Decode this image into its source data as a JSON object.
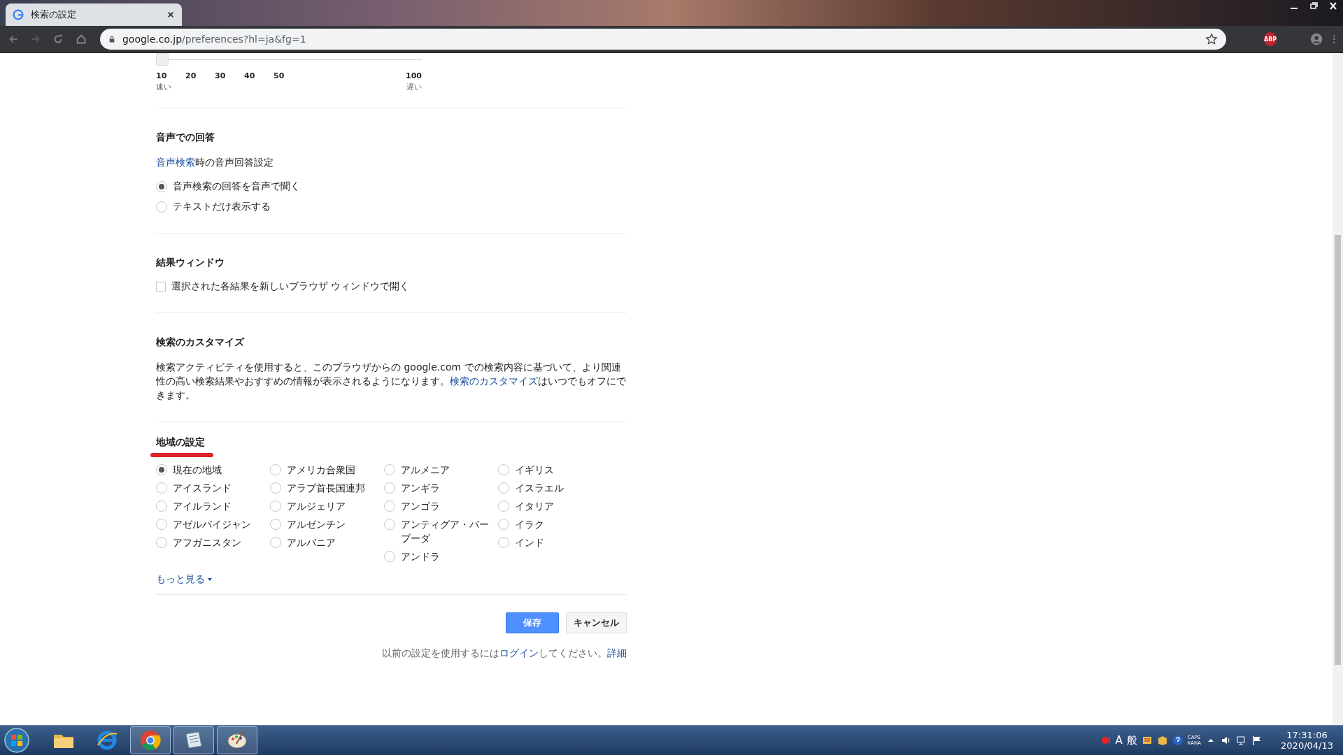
{
  "browser": {
    "tab": {
      "title": "検索の設定"
    },
    "address": {
      "host": "google.co.jp",
      "path": "/preferences?hl=ja&fg=1"
    },
    "extension_badge": "ABP"
  },
  "page": {
    "slider": {
      "ticks": [
        "10",
        "20",
        "30",
        "40",
        "50",
        "100"
      ],
      "low_label": "速い",
      "high_label": "遅い",
      "level": 0
    },
    "voice": {
      "heading": "音声での回答",
      "description": [
        {
          "text": "音声検索",
          "link": true
        },
        {
          "text": "時の音声回答設定",
          "link": false
        }
      ],
      "options": [
        {
          "label": "音声検索の回答を音声で聞く",
          "selected": true
        },
        {
          "label": "テキストだけ表示する",
          "selected": false
        }
      ]
    },
    "results_window": {
      "heading": "結果ウィンドウ",
      "checkbox": {
        "label": "選択された各結果を新しいブラウザ ウィンドウで開く",
        "checked": false
      }
    },
    "customize": {
      "heading": "検索のカスタマイズ",
      "paragraph": [
        {
          "text": "検索アクティビティを使用すると、このブラウザからの google.com での検索内容に基づいて、より関連性の高い検索結果やおすすめの情報が表示されるようになります。",
          "link": false
        },
        {
          "text": "検索のカスタマイズ",
          "link": true
        },
        {
          "text": "はいつでもオフにできます。",
          "link": false
        }
      ]
    },
    "region": {
      "heading": "地域の設定",
      "columns": [
        [
          {
            "label": "現在の地域",
            "selected": true
          },
          {
            "label": "アイスランド",
            "selected": false
          },
          {
            "label": "アイルランド",
            "selected": false
          },
          {
            "label": "アゼルバイジャン",
            "selected": false
          },
          {
            "label": "アフガニスタン",
            "selected": false
          }
        ],
        [
          {
            "label": "アメリカ合衆国",
            "selected": false
          },
          {
            "label": "アラブ首長国連邦",
            "selected": false
          },
          {
            "label": "アルジェリア",
            "selected": false
          },
          {
            "label": "アルゼンチン",
            "selected": false
          },
          {
            "label": "アルバニア",
            "selected": false
          }
        ],
        [
          {
            "label": "アルメニア",
            "selected": false
          },
          {
            "label": "アンギラ",
            "selected": false
          },
          {
            "label": "アンゴラ",
            "selected": false
          },
          {
            "label": "アンティグア・バーブーダ",
            "selected": false
          },
          {
            "label": "アンドラ",
            "selected": false
          }
        ],
        [
          {
            "label": "イギリス",
            "selected": false
          },
          {
            "label": "イスラエル",
            "selected": false
          },
          {
            "label": "イタリア",
            "selected": false
          },
          {
            "label": "イラク",
            "selected": false
          },
          {
            "label": "インド",
            "selected": false
          }
        ]
      ],
      "more_link": "もっと見る"
    },
    "buttons": [
      {
        "label": "保存",
        "kind": "primary"
      },
      {
        "label": "キャンセル",
        "kind": "secondary"
      }
    ],
    "footer": [
      {
        "text": "以前の設定を使用するには",
        "link": false
      },
      {
        "text": "ログイン",
        "link": true
      },
      {
        "text": "してください。",
        "link": false
      },
      {
        "text": "詳細",
        "link": true
      }
    ]
  },
  "taskbar": {
    "apps": [
      {
        "kind": "folder",
        "running": false
      },
      {
        "kind": "ie",
        "running": false
      },
      {
        "kind": "chrome",
        "running": true
      },
      {
        "kind": "document",
        "running": true
      },
      {
        "kind": "paint",
        "running": true
      }
    ],
    "ime": [
      "A",
      "般"
    ],
    "caps": "CAPS",
    "kana": "KANA",
    "time": "17:31:06",
    "date": "2020/04/13"
  }
}
